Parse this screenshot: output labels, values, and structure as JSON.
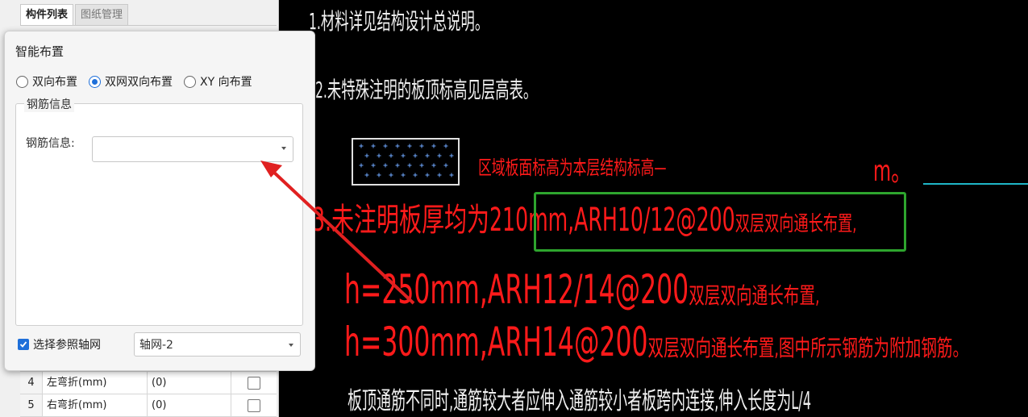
{
  "left_panel": {
    "tabs": [
      {
        "label": "构件列表"
      },
      {
        "label": "图纸管理"
      }
    ],
    "grid_rows": [
      {
        "num": "4",
        "name": "左弯折(mm)",
        "value": "(0)"
      },
      {
        "num": "5",
        "name": "右弯折(mm)",
        "value": "(0)"
      }
    ]
  },
  "dialog": {
    "title": "智能布置",
    "radio_options": [
      {
        "label": "双向布置",
        "selected": false
      },
      {
        "label": "双网双向布置",
        "selected": true
      },
      {
        "label": "XY 向布置",
        "selected": false
      }
    ],
    "rebar_group_label": "钢筋信息",
    "rebar_field_label": "钢筋信息:",
    "rebar_value": "",
    "axis_checkbox_label": "选择参照轴网",
    "axis_checked": true,
    "axis_value": "轴网-2"
  },
  "cad": {
    "note1": "1.材料详见结构设计总说明。",
    "note2": "2.未特殊注明的板顶标高见层高表。",
    "region_label": "区域板面标高为本层结构标高—",
    "m_label": "m。",
    "note3_prefix": "3.未注明板厚均为210mm",
    "note3_highlight": ",ARH10/12@200",
    "note3_suffix": "双层双向通长布置,",
    "h250": "h=250mm,ARH12/14@200",
    "h250_suffix": "双层双向通长布置,",
    "h300": "h=300mm,ARH14@200",
    "h300_suffix": "双层双向通长布置,图中所示钢筋为附加钢筋。",
    "note_bottom": "板顶通筋不同时,通筋较大者应伸入通筋较小者板跨内连接,伸入长度为L/4",
    "colors": {
      "text_white": "#f0f0f0",
      "text_red": "#ff1a1a",
      "highlight_box": "#2ea52e",
      "cyan_line": "#1fb6c8",
      "arrow": "#e02020"
    }
  }
}
